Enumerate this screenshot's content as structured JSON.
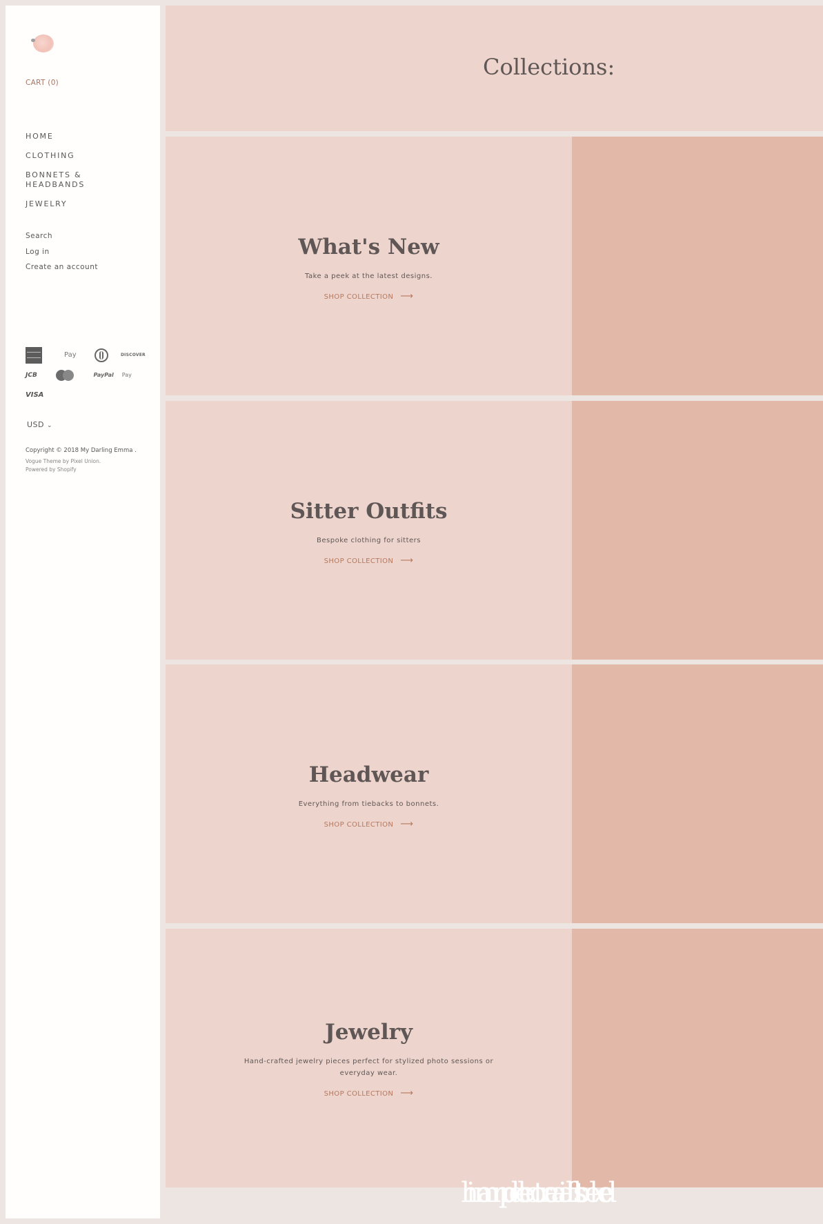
{
  "sidebar": {
    "logo_alt": "My Darling Emma logo",
    "cart_label": "CART (0)",
    "nav": [
      {
        "label": "HOME"
      },
      {
        "label": "CLOTHING"
      },
      {
        "label": "BONNETS & HEADBANDS"
      },
      {
        "label": "JEWELRY"
      }
    ],
    "account_links": [
      {
        "label": "Search"
      },
      {
        "label": "Log in"
      },
      {
        "label": "Create an account"
      }
    ],
    "payment_icons": {
      "amex": "american-express",
      "apple_pay": " Pay",
      "diners": "diners-club",
      "discover": "DISCOVER",
      "jcb": "JCB",
      "master": "mastercard",
      "paypal": "PayPal",
      "shop_pay": "Pay",
      "visa": "VISA"
    },
    "currency": "USD",
    "currency_caret": "⌄",
    "copyright": "Copyright © 2018 My Darling Emma .",
    "theme_credit": "Vogue Theme by Pixel Union.",
    "powered_by": "Powered by Shopify"
  },
  "main": {
    "page_title": "Collections:",
    "collections": [
      {
        "title": "What's New",
        "description": "Take a peek at the latest designs.",
        "link": "SHOP COLLECTION"
      },
      {
        "title": "Sitter Outfits",
        "description": "Bespoke clothing for sitters",
        "link": "SHOP COLLECTION"
      },
      {
        "title": "Headwear",
        "description": "Everything from tiebacks to bonnets.",
        "link": "SHOP COLLECTION"
      },
      {
        "title": "Jewelry",
        "description": "Hand-crafted jewelry pieces perfect for stylized photo sessions or everyday wear.",
        "link": "SHOP COLLECTION"
      }
    ],
    "arrow": "⟶",
    "overlay_words": [
      "handcrafted",
      "impeccable",
      "details"
    ],
    "colors": {
      "background": "#ede5e1",
      "panel": "#edd4cc",
      "image_placeholder": "#e2b8a8",
      "accent": "#b5785e",
      "text": "#5f5656"
    }
  }
}
